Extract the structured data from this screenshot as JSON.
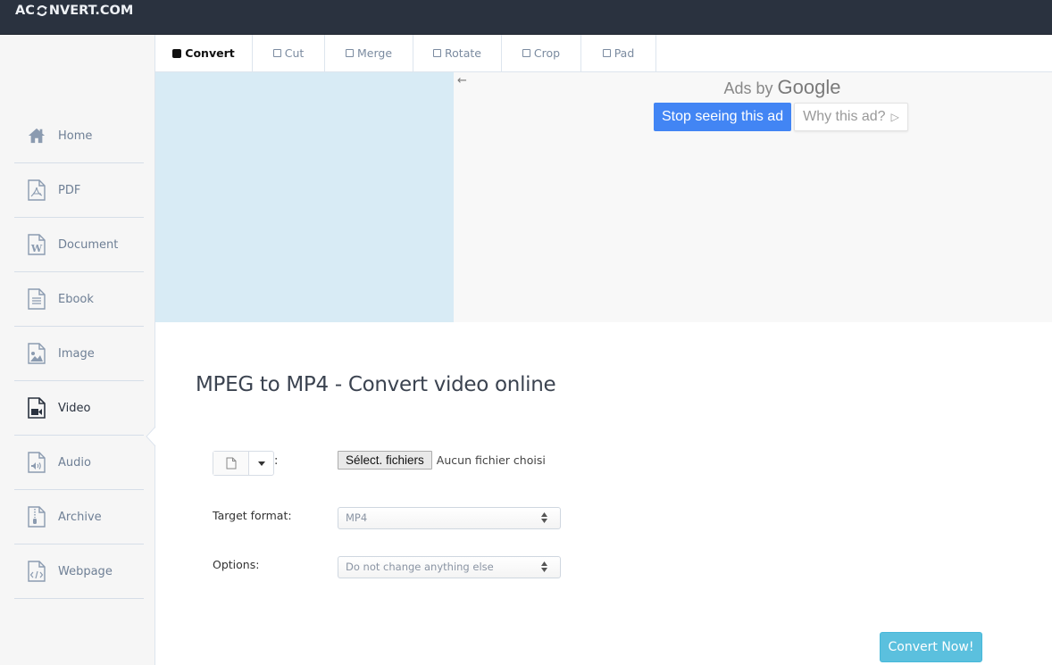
{
  "header": {
    "logo_left": "AC",
    "logo_icon": "refresh-icon",
    "logo_right": "NVERT.COM"
  },
  "sidebar": {
    "items": [
      {
        "label": "Home",
        "icon": "home-icon",
        "active": false
      },
      {
        "label": "PDF",
        "icon": "pdf-file-icon",
        "active": false
      },
      {
        "label": "Document",
        "icon": "word-file-icon",
        "active": false
      },
      {
        "label": "Ebook",
        "icon": "text-file-icon",
        "active": false
      },
      {
        "label": "Image",
        "icon": "image-file-icon",
        "active": false
      },
      {
        "label": "Video",
        "icon": "video-file-icon",
        "active": true
      },
      {
        "label": "Audio",
        "icon": "audio-file-icon",
        "active": false
      },
      {
        "label": "Archive",
        "icon": "archive-file-icon",
        "active": false
      },
      {
        "label": "Webpage",
        "icon": "code-file-icon",
        "active": false
      }
    ]
  },
  "tabs": [
    {
      "label": "Convert",
      "active": true
    },
    {
      "label": "Cut",
      "active": false
    },
    {
      "label": "Merge",
      "active": false
    },
    {
      "label": "Rotate",
      "active": false
    },
    {
      "label": "Crop",
      "active": false
    },
    {
      "label": "Pad",
      "active": false
    }
  ],
  "ad": {
    "back_icon": "←",
    "ads_by": "Ads by",
    "google": "Google",
    "stop_label": "Stop seeing this ad",
    "why_label": "Why this ad?",
    "why_icon": "▷"
  },
  "main": {
    "title": "MPEG to MP4 - Convert video online",
    "source_colon": ":",
    "file_button": "Sélect. fichiers",
    "file_status": "Aucun fichier choisi",
    "target_label": "Target format:",
    "target_value": "MP4",
    "options_label": "Options:",
    "options_value": "Do not change anything else",
    "convert_label": "Convert Now!"
  },
  "colors": {
    "header_bg": "#2a323f",
    "ad_primary": "#4285f4",
    "convert_button": "#5bc0de",
    "sidebar_text": "#6e7f95"
  }
}
